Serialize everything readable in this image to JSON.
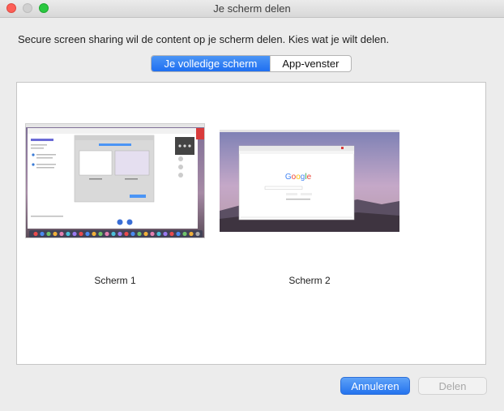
{
  "window": {
    "title": "Je scherm delen"
  },
  "prompt": "Secure screen sharing wil de content op je scherm delen. Kies wat je wilt delen.",
  "tabs": [
    {
      "label": "Je volledige scherm",
      "selected": true
    },
    {
      "label": "App-venster",
      "selected": false
    }
  ],
  "screens": [
    {
      "label": "Scherm 1"
    },
    {
      "label": "Scherm 2",
      "logo_text": "Google"
    }
  ],
  "buttons": {
    "cancel": "Annuleren",
    "share": "Delen"
  },
  "colors": {
    "accent": "#1f6ff1",
    "close": "#fd5f57",
    "maximize": "#2ac840"
  }
}
